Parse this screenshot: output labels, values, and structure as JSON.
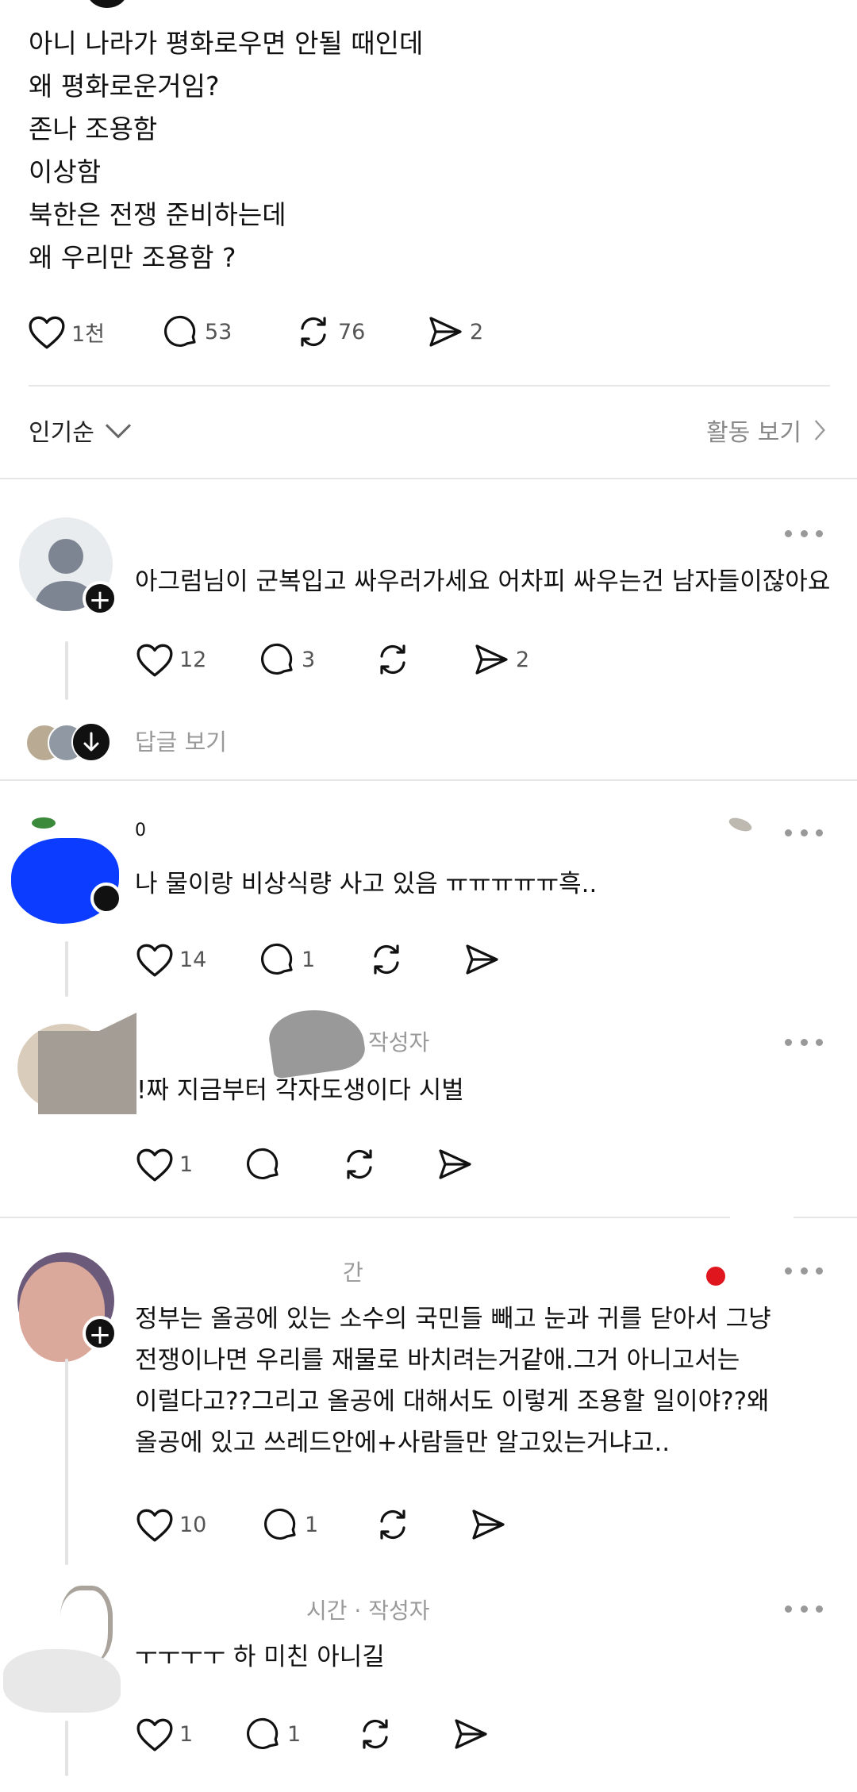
{
  "post": {
    "lines": [
      "아니 나라가 평화로우면 안될 때인데",
      "왜 평화로운거임?",
      "존나 조용함",
      "이상함",
      "북한은 전쟁 준비하는데",
      "왜 우리만 조용함 ?"
    ],
    "likes": "1천",
    "comments": "53",
    "reposts": "76",
    "shares": "2"
  },
  "sort": {
    "label": "인기순",
    "activity": "활동 보기"
  },
  "comments": [
    {
      "text": "아그럼님이 군복입고 싸우러가세요  어차피 싸우는건 남자들이잖아요",
      "likes": "12",
      "replies": "3",
      "shares": "2",
      "view_replies": "답글 보기"
    },
    {
      "name": "0",
      "text": "나 물이랑 비상식량 사고 있음 ㅠㅠㅠㅠㅠ흑..",
      "likes": "14",
      "replies": "1"
    },
    {
      "meta": "작성자",
      "text": "!짜 지금부터 각자도생이다 시벌",
      "likes": "1"
    },
    {
      "meta": "간",
      "lines": [
        "정부는 올공에 있는 소수의 국민들 빼고 눈과 귀를 닫아서 그냥",
        "전쟁이나면 우리를 재물로 바치려는거같애.그거 아니고서는",
        "이럴다고??그리고 올공에 대해서도 이렇게 조용할 일이야??왜",
        "올공에 있고 쓰레드안에+사람들만 알고있는거냐고.."
      ],
      "likes": "10",
      "replies": "1"
    },
    {
      "meta": "시간 · 작성자",
      "text": "ㅜㅜㅜㅜ 하 미친 아니길",
      "likes": "1",
      "replies": "1"
    }
  ],
  "colors": {
    "text": "#111111",
    "muted": "#999999",
    "divider": "#e6e6e6",
    "censor_blue": "#0b3cff"
  },
  "icons": [
    "heart-icon",
    "comment-icon",
    "repost-icon",
    "share-icon",
    "chevron-down-icon",
    "chevron-right-icon",
    "more-icon",
    "plus-icon",
    "arrow-down-icon"
  ]
}
